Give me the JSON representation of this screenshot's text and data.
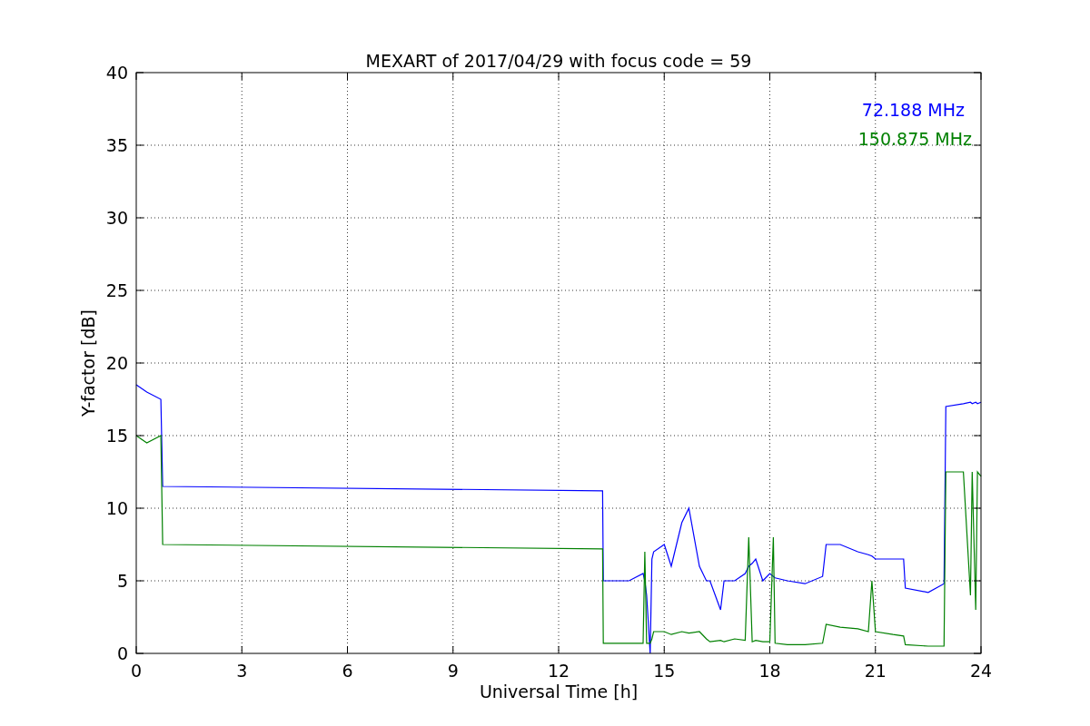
{
  "chart_data": {
    "type": "line",
    "title": "MEXART of 2017/04/29 with focus code = 59",
    "xlabel": "Universal Time [h]",
    "ylabel": "Y-factor [dB]",
    "x": [
      0,
      0.3,
      0.7,
      0.75,
      13.25,
      13.27,
      14,
      14.4,
      14.45,
      14.5,
      14.6,
      14.65,
      14.7,
      15,
      15.2,
      15.5,
      15.7,
      16,
      16.2,
      16.3,
      16.6,
      16.7,
      17,
      17.3,
      17.4,
      17.5,
      17.6,
      17.8,
      18,
      18.1,
      18.15,
      18.5,
      19,
      19.5,
      19.6,
      20,
      20.5,
      20.8,
      20.9,
      21,
      21.5,
      21.8,
      21.85,
      22.5,
      22.95,
      23,
      23.5,
      23.7,
      23.75,
      23.85,
      23.9,
      24
    ],
    "series": [
      {
        "name": "72.188 MHz",
        "color": "#0000ff",
        "values": [
          18.5,
          18,
          17.5,
          11.5,
          11.2,
          5,
          5,
          5.5,
          5,
          4,
          0,
          6.5,
          7,
          7.5,
          6,
          9,
          10,
          6,
          5,
          5,
          3,
          5,
          5,
          5.5,
          6,
          6.2,
          6.5,
          5,
          5.5,
          5.3,
          5.2,
          5,
          4.8,
          5.3,
          7.5,
          7.5,
          7,
          6.8,
          6.7,
          6.5,
          6.5,
          6.5,
          4.5,
          4.2,
          4.8,
          17,
          17.2,
          17.3,
          17.2,
          17.3,
          17.2,
          17.3
        ]
      },
      {
        "name": "150.875 MHz",
        "color": "#008000",
        "values": [
          15,
          14.5,
          15,
          7.5,
          7.2,
          0.7,
          0.7,
          0.7,
          7,
          0.7,
          0.7,
          1,
          1.5,
          1.5,
          1.3,
          1.5,
          1.4,
          1.5,
          1,
          0.8,
          0.9,
          0.8,
          1,
          0.9,
          8,
          0.8,
          0.9,
          0.8,
          0.8,
          8,
          0.7,
          0.6,
          0.6,
          0.7,
          2,
          1.8,
          1.7,
          1.5,
          5,
          1.5,
          1.3,
          1.2,
          0.6,
          0.5,
          0.5,
          12.5,
          12.5,
          4,
          12.5,
          3,
          12.5,
          12.2
        ]
      }
    ],
    "xlim": [
      0,
      24
    ],
    "ylim": [
      0,
      40
    ],
    "xticks": [
      0,
      3,
      6,
      9,
      12,
      15,
      18,
      21,
      24
    ],
    "yticks": [
      0,
      5,
      10,
      15,
      20,
      25,
      30,
      35,
      40
    ],
    "grid": true
  }
}
